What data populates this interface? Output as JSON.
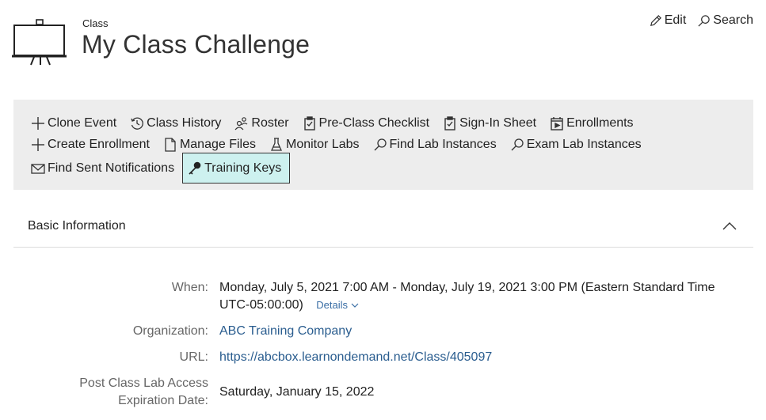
{
  "header": {
    "section_label": "Class",
    "title": "My Class Challenge",
    "actions": {
      "edit": "Edit",
      "search": "Search"
    }
  },
  "toolbar": {
    "row1": [
      "Clone Event",
      "Class History",
      "Roster",
      "Pre-Class Checklist",
      "Sign-In Sheet",
      "Enrollments"
    ],
    "row2": [
      "Create Enrollment",
      "Manage Files",
      "Monitor Labs",
      "Find Lab Instances",
      "Exam Lab Instances"
    ],
    "row3": [
      "Find Sent Notifications",
      "Training Keys"
    ]
  },
  "basic_info": {
    "title": "Basic Information",
    "when_label": "When:",
    "when_value_line1": "Monday, July 5, 2021 7:00 AM - Monday, July 19, 2021 3:00 PM (Eastern Standard Time",
    "when_value_line2": "UTC-05:00:00)",
    "details_label": "Details",
    "organization_label": "Organization:",
    "organization_value": "ABC Training Company",
    "url_label": "URL:",
    "url_value": "https://abcbox.learnondemand.net/Class/405097",
    "post_class_label_line1": "Post Class Lab Access",
    "post_class_label_line2": "Expiration Date:",
    "post_class_value": "Saturday, January 15, 2022"
  },
  "colors": {
    "selected_bg": "#cdf1ef",
    "toolbar_bg": "#ededed",
    "link": "#2a5d8f"
  }
}
